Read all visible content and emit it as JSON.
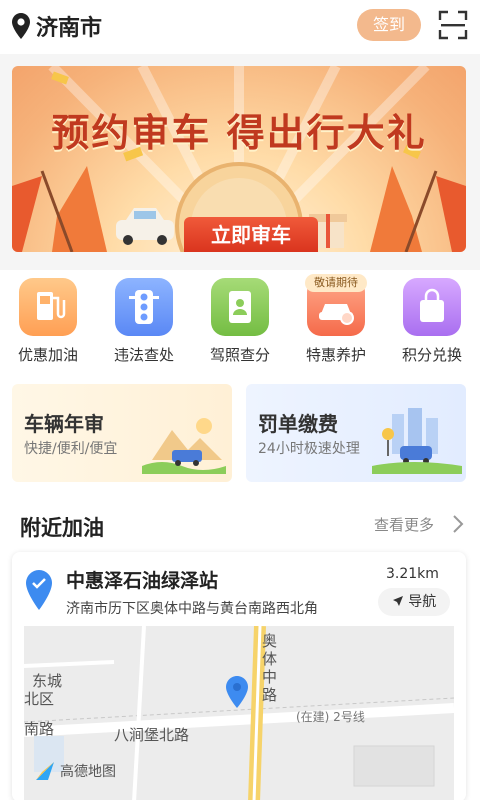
{
  "header": {
    "city": "济南市",
    "signin_label": "签到"
  },
  "banner": {
    "title": "预约审车 得出行大礼",
    "button_label": "立即审车"
  },
  "quick_actions": [
    {
      "label": "优惠加油",
      "icon": "gas-pump-icon",
      "color": "#ffb26b"
    },
    {
      "label": "违法查处",
      "icon": "traffic-light-icon",
      "color": "#6e9cff"
    },
    {
      "label": "驾照查分",
      "icon": "license-book-icon",
      "color": "#8ccd5a"
    },
    {
      "label": "特惠养护",
      "icon": "car-wash-icon",
      "color": "#ff8a66",
      "badge": "敬请期待"
    },
    {
      "label": "积分兑换",
      "icon": "shopping-bag-icon",
      "color": "#c48cf5"
    }
  ],
  "service_cards": [
    {
      "title": "车辆年审",
      "subtitle": "快捷/便利/便宜"
    },
    {
      "title": "罚单缴费",
      "subtitle": "24小时极速处理"
    }
  ],
  "nearby": {
    "title": "附近加油",
    "more_label": "查看更多",
    "station": {
      "name": "中惠泽石油绿泽站",
      "address": "济南市历下区奥体中路与黄台南路西北角",
      "distance": "3.21km",
      "nav_label": "导航"
    },
    "map": {
      "road_vertical": "奥体中路",
      "road_horizontal": "八涧堡北路",
      "road_left": "南路",
      "district": "东城",
      "district2": "北区",
      "construction": "(在建) 2号线",
      "provider": "高德地图"
    }
  }
}
